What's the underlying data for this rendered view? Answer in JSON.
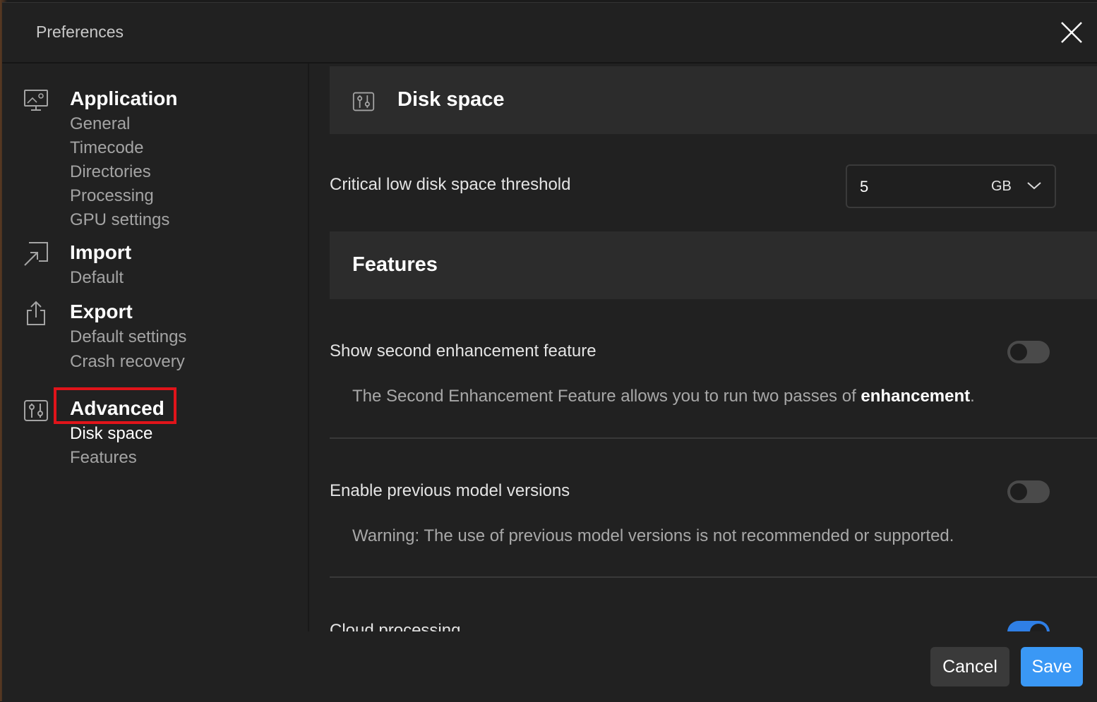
{
  "dialog": {
    "title": "Preferences"
  },
  "sidebar": {
    "groups": [
      {
        "icon": "monitor-settings-icon",
        "label": "Application",
        "items": [
          "General",
          "Timecode",
          "Directories",
          "Processing",
          "GPU settings"
        ]
      },
      {
        "icon": "import-arrow-icon",
        "label": "Import",
        "items": [
          "Default"
        ]
      },
      {
        "icon": "export-share-icon",
        "label": "Export",
        "items": [
          "Default settings",
          "Crash recovery"
        ]
      },
      {
        "icon": "sliders-icon",
        "label": "Advanced",
        "items": [
          "Disk space",
          "Features"
        ],
        "active": true
      }
    ]
  },
  "main": {
    "disk_space": {
      "icon": "sliders-icon",
      "title": "Disk space",
      "threshold_label": "Critical low disk space threshold",
      "threshold_value": "5",
      "threshold_unit": "GB"
    },
    "features": {
      "title": "Features",
      "settings": [
        {
          "label": "Show second enhancement feature",
          "description_prefix": "The Second Enhancement Feature allows you to run two passes of ",
          "description_bold": "enhancement",
          "description_suffix": ".",
          "enabled": false
        },
        {
          "label": "Enable previous model versions",
          "description": "Warning: The use of previous model versions is not recommended or supported.",
          "enabled": false
        },
        {
          "label": "Cloud processing",
          "enabled": true
        }
      ]
    }
  },
  "footer": {
    "cancel_label": "Cancel",
    "save_label": "Save"
  },
  "colors": {
    "accent": "#3a98f5",
    "highlight": "#e0141a",
    "background": "#212121"
  }
}
